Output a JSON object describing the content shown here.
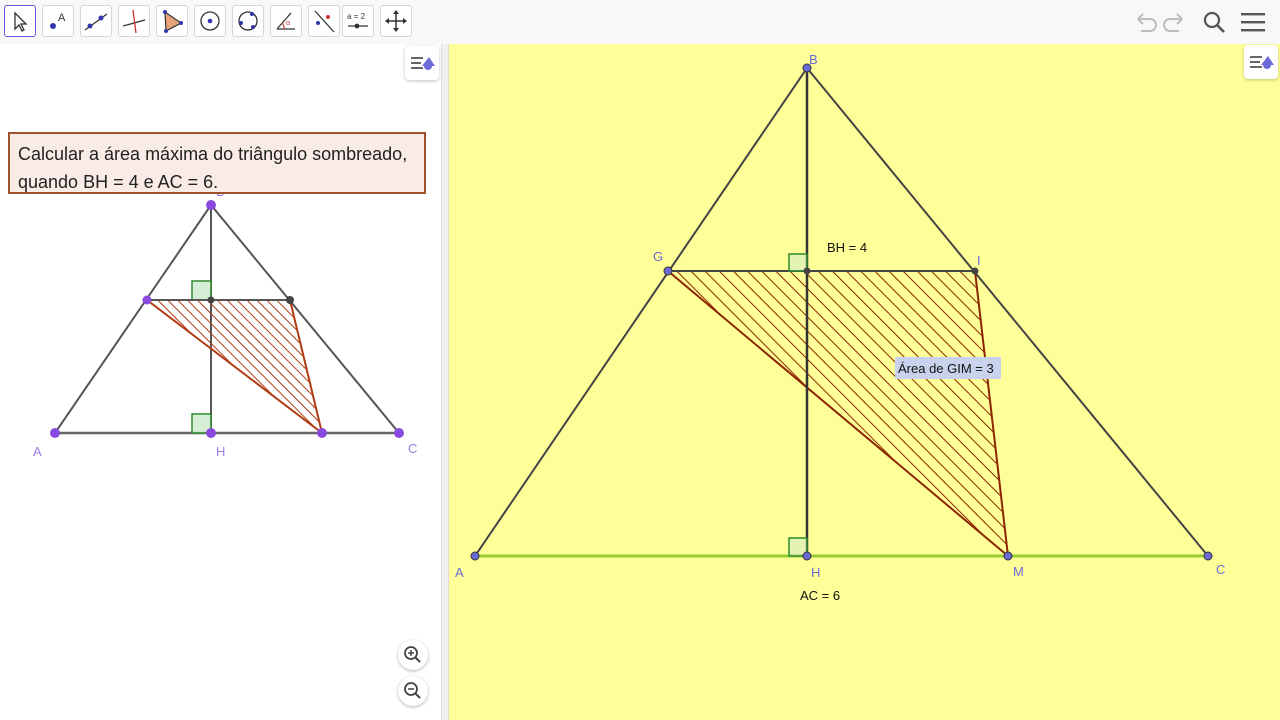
{
  "toolbar": {
    "tools": [
      "move",
      "point",
      "line",
      "perpendicular-line",
      "polygon",
      "circle-center-point",
      "circle-through-points",
      "angle",
      "reflect",
      "slider",
      "move-graphics-view"
    ],
    "slider_label": "a = 2"
  },
  "algebra": {
    "text_line1": "Calcular a área máxima do triângulo sombreado,",
    "text_line2": "quando BH = 4 e AC = 6."
  },
  "preview": {
    "labels": {
      "A": "A",
      "B": "B",
      "C": "C",
      "H": "H"
    }
  },
  "graphics": {
    "labels": {
      "A": "A",
      "B": "B",
      "C": "C",
      "G": "G",
      "H": "H",
      "I": "I",
      "M": "M"
    },
    "bh_label": "BH = 4",
    "ac_label": "AC = 6",
    "area_label": "Área de  GIM = 3"
  },
  "colors": {
    "graphics_bg": "#ffff99",
    "shaded_stroke": "#8b2500",
    "base_green": "#9acd32",
    "point_blue": "#6b6bd8",
    "point_purple": "#8a4ae0",
    "right_angle_green": "#2e8b2e",
    "selected_tool": "#6557d2"
  }
}
